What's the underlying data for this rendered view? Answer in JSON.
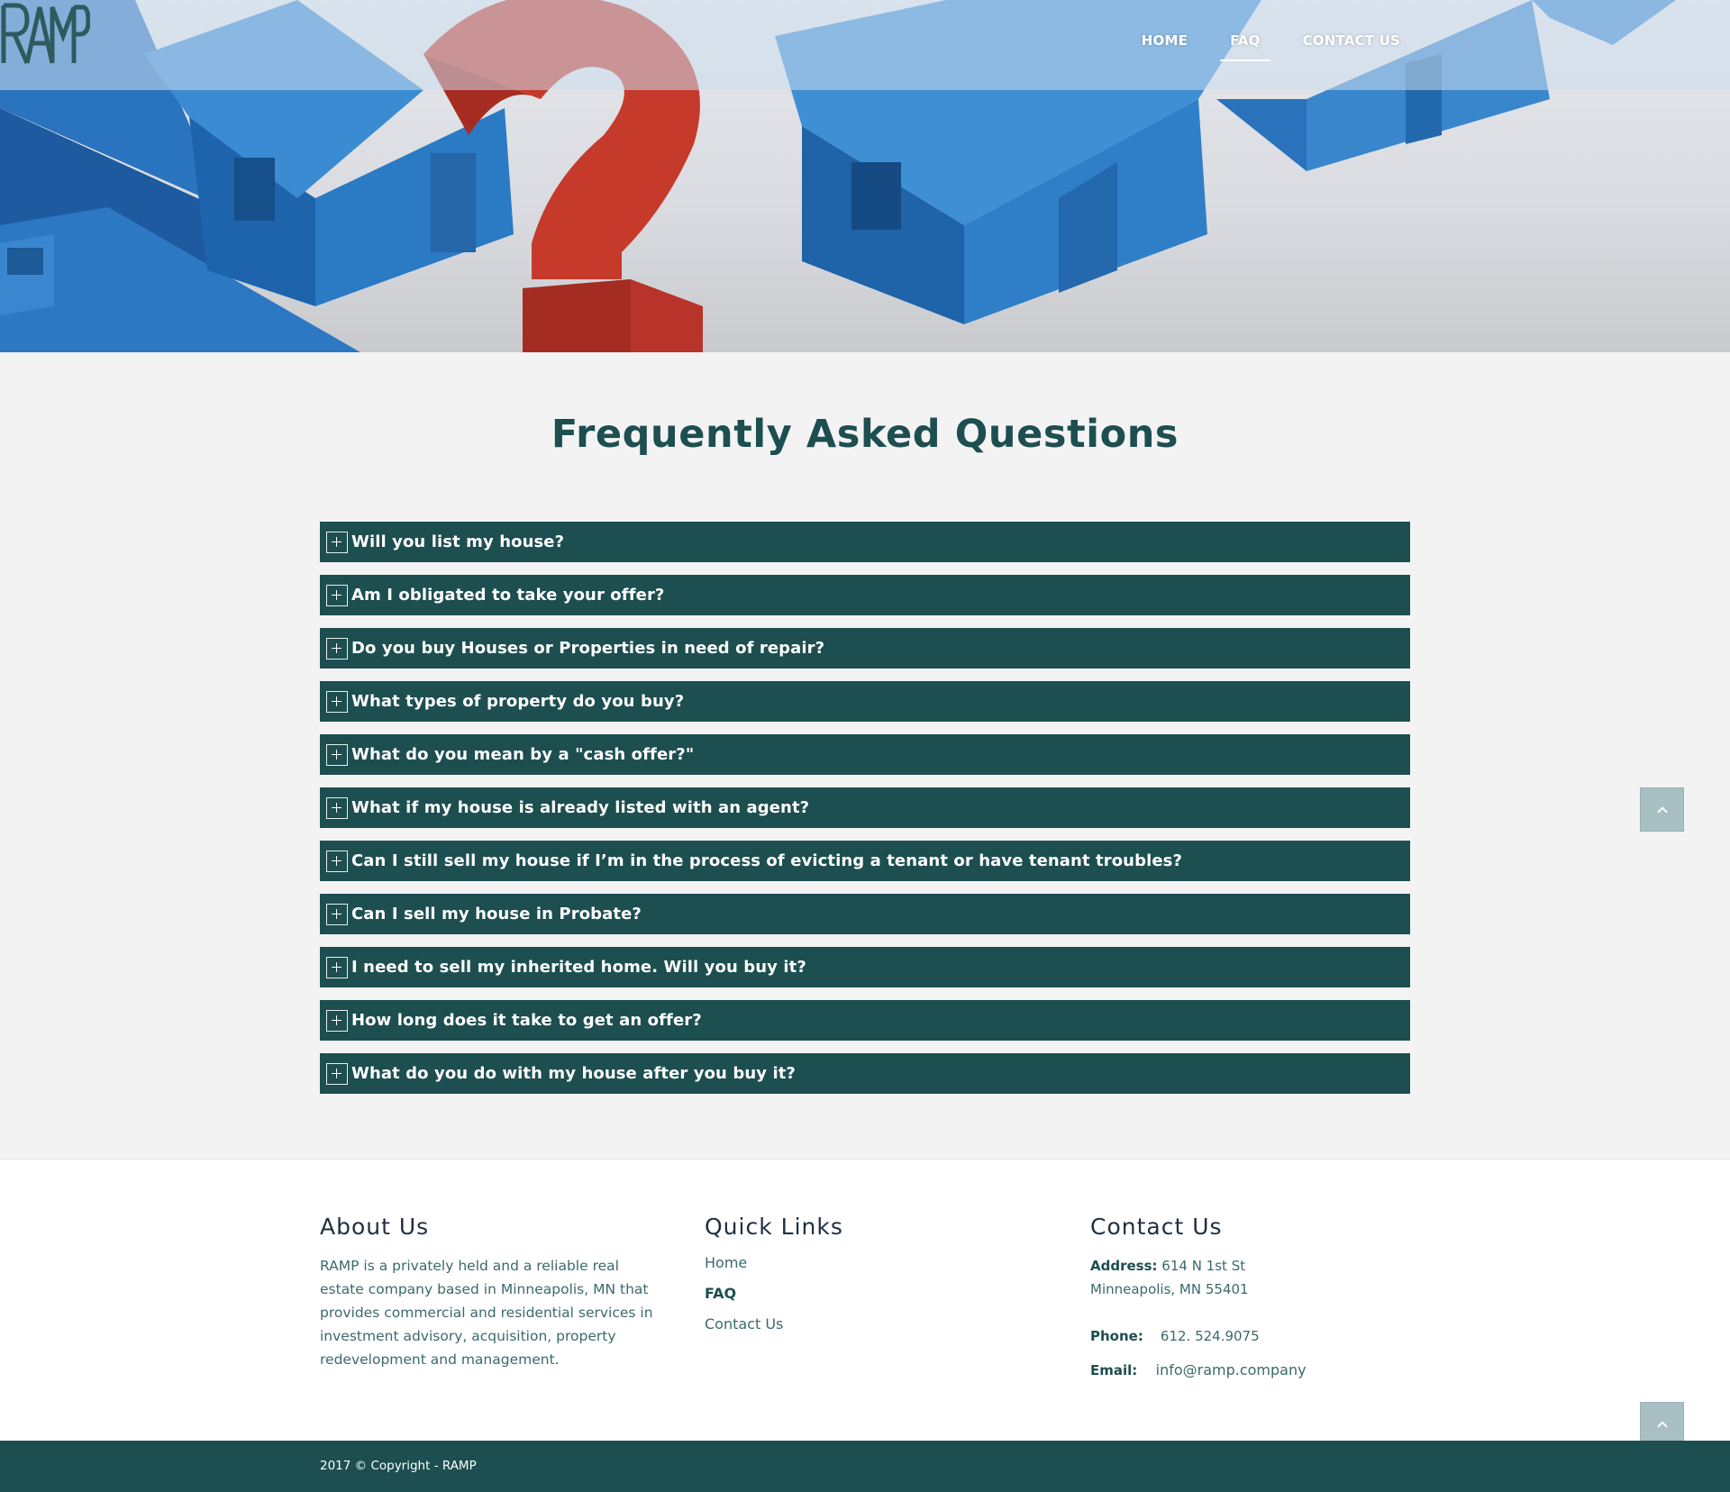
{
  "brand": {
    "logo_text": "RAMP"
  },
  "nav": {
    "items": [
      {
        "label": "HOME"
      },
      {
        "label": "FAQ"
      },
      {
        "label": "CONTACT US"
      }
    ]
  },
  "main": {
    "title": "Frequently Asked Questions",
    "faqs": [
      {
        "question": "Will you list my house?"
      },
      {
        "question": "Am I obligated to take your offer?"
      },
      {
        "question": "Do you buy Houses or Properties in need of repair?"
      },
      {
        "question": "What types of property do you buy?"
      },
      {
        "question": "What do you mean by a \"cash offer?\""
      },
      {
        "question": "What if my house is already listed with an agent?"
      },
      {
        "question": "Can I still sell my house if I’m in the process of evicting a tenant or have tenant troubles?"
      },
      {
        "question": "Can I sell my house in Probate?"
      },
      {
        "question": "I need to sell my inherited home. Will you buy it?"
      },
      {
        "question": "How long does it take to get an offer?"
      },
      {
        "question": "What do you do with my house after you buy it?"
      }
    ]
  },
  "footer": {
    "about": {
      "heading": "About Us",
      "text": "RAMP is a privately held and a reliable real estate company based in Minneapolis, MN that provides commercial and residential services in investment advisory, acquisition, property redevelopment and management."
    },
    "links": {
      "heading": "Quick Links",
      "items": [
        {
          "label": "Home"
        },
        {
          "label": "FAQ"
        },
        {
          "label": "Contact Us"
        }
      ]
    },
    "contact": {
      "heading": "Contact Us",
      "address_label": "Address:",
      "address_line1": "614 N 1st St",
      "address_line2": "Minneapolis, MN 55401",
      "phone_label": "Phone:",
      "phone": "612. 524.9075",
      "email_label": "Email:",
      "email": "info@ramp.company"
    }
  },
  "copyright": "2017 © Copyright - RAMP",
  "colors": {
    "brand_teal": "#1d4e50",
    "roof_blue": "#2e79c0",
    "question_red": "#c53a2a",
    "scroll_button": "#a8c0c3"
  },
  "icons": [
    "plus-icon",
    "chevron-up-icon",
    "ramp-logo"
  ]
}
